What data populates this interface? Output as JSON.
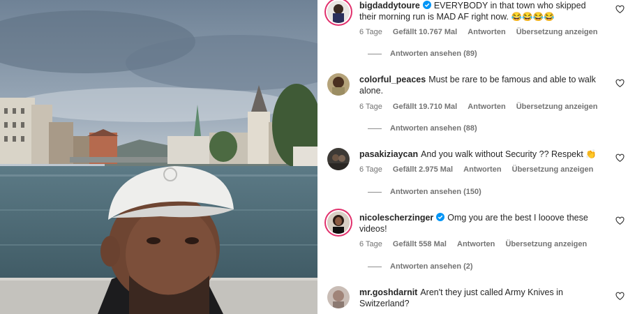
{
  "comments": [
    {
      "username": "bigdaddytoure",
      "verified": true,
      "text": "EVERYBODY in that town who skipped their morning run is MAD AF right now. 😂😂😂😂",
      "time": "6 Tage",
      "likes": "Gefällt 10.767 Mal",
      "reply": "Antworten",
      "translate": "Übersetzung anzeigen",
      "view_replies": "Antworten ansehen (89)"
    },
    {
      "username": "colorful_peaces",
      "verified": false,
      "text": "Must be rare to be famous and able to walk alone.",
      "time": "6 Tage",
      "likes": "Gefällt 19.710 Mal",
      "reply": "Antworten",
      "translate": "Übersetzung anzeigen",
      "view_replies": "Antworten ansehen (88)"
    },
    {
      "username": "pasakiziaycan",
      "verified": false,
      "text": "And you walk without Security ?? Respekt 👏",
      "time": "6 Tage",
      "likes": "Gefällt 2.975 Mal",
      "reply": "Antworten",
      "translate": "Übersetzung anzeigen",
      "view_replies": "Antworten ansehen (150)"
    },
    {
      "username": "nicolescherzinger",
      "verified": true,
      "text": "Omg you are the best I looove these videos!",
      "time": "6 Tage",
      "likes": "Gefällt 558 Mal",
      "reply": "Antworten",
      "translate": "Übersetzung anzeigen",
      "view_replies": "Antworten ansehen (2)"
    },
    {
      "username": "mr.goshdarnit",
      "verified": false,
      "text": "Aren't they just called Army Knives in Switzerland?"
    }
  ],
  "icons": {
    "heart": "heart-outline-icon",
    "verified": "verified-badge-icon"
  },
  "colors": {
    "verified_blue": "#0095f6",
    "story_ring": "#e1306c",
    "meta_gray": "#737373"
  }
}
